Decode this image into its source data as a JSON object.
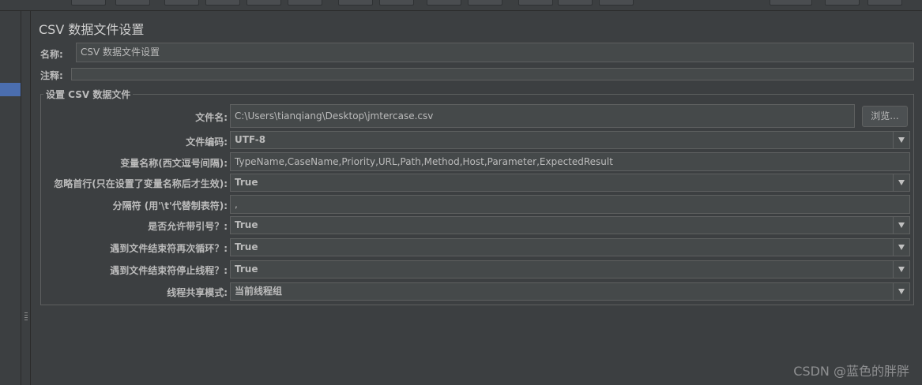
{
  "panel": {
    "title": "CSV 数据文件设置",
    "name_label": "名称:",
    "name_value": "CSV 数据文件设置",
    "comment_label": "注释:",
    "comment_value": ""
  },
  "group": {
    "title": "设置 CSV 数据文件",
    "browse_label": "浏览...",
    "rows": [
      {
        "label": "文件名:",
        "value": "C:\\Users\\tianqiang\\Desktop\\jmtercase.csv",
        "kind": "text"
      },
      {
        "label": "文件编码:",
        "value": "UTF-8",
        "kind": "combo"
      },
      {
        "label": "变量名称(西文逗号间隔):",
        "value": "TypeName,CaseName,Priority,URL,Path,Method,Host,Parameter,ExpectedResult",
        "kind": "text"
      },
      {
        "label": "忽略首行(只在设置了变量名称后才生效):",
        "value": "True",
        "kind": "combo"
      },
      {
        "label": "分隔符 (用'\\t'代替制表符):",
        "value": ",",
        "kind": "text"
      },
      {
        "label": "是否允许带引号？:",
        "value": "True",
        "kind": "combo"
      },
      {
        "label": "遇到文件结束符再次循环？:",
        "value": "True",
        "kind": "combo"
      },
      {
        "label": "遇到文件结束符停止线程？:",
        "value": "True",
        "kind": "combo"
      },
      {
        "label": "线程共享模式:",
        "value": "当前线程组",
        "kind": "combo"
      }
    ]
  },
  "watermark": "CSDN @蓝色的胖胖",
  "colors": {
    "background": "#3c3f41",
    "field": "#45494a",
    "selection": "#4b6eaf"
  },
  "icons": [
    "chevron-down-icon",
    "splitter-grip-icon"
  ]
}
